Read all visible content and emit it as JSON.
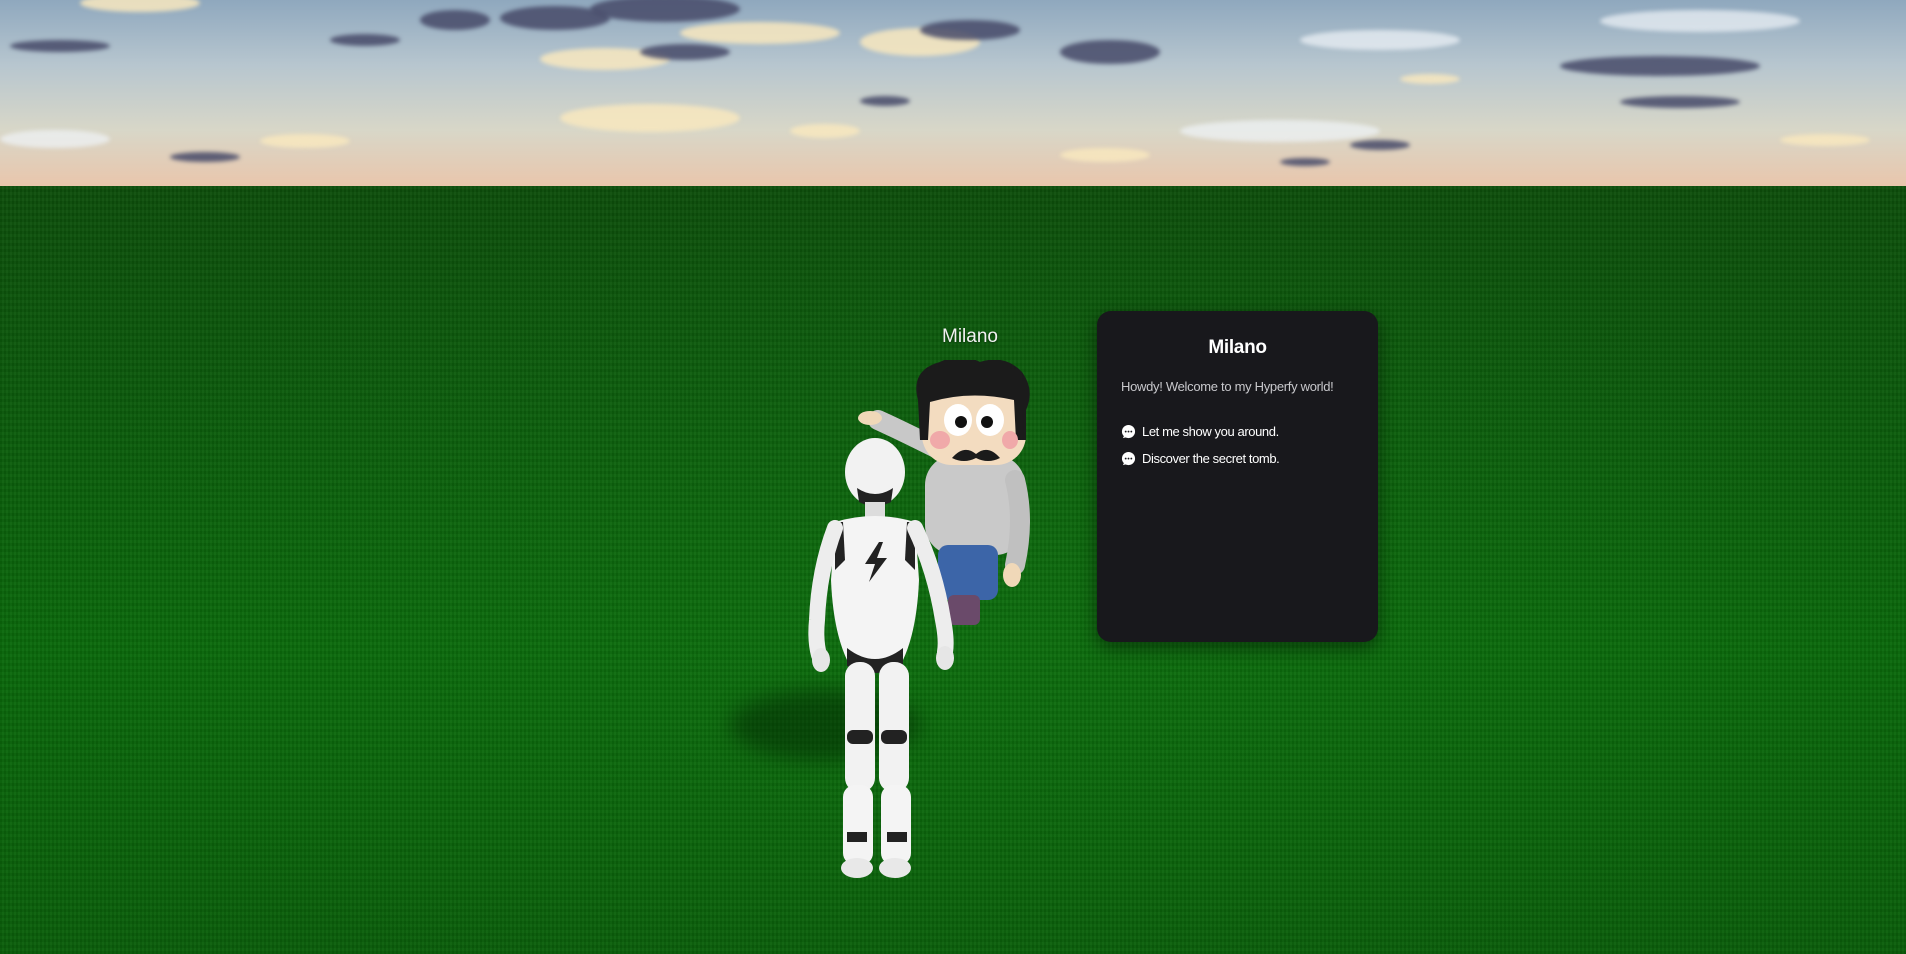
{
  "npc": {
    "nametag": "Milano"
  },
  "dialog": {
    "title": "Milano",
    "message": "Howdy! Welcome to my Hyperfy world!",
    "options": [
      {
        "label": "Let me show you around.",
        "icon": "chat-bubble-icon"
      },
      {
        "label": "Discover the secret tomb.",
        "icon": "chat-bubble-icon"
      }
    ]
  },
  "colors": {
    "panel_bg": "#18181c",
    "ground": "#0a6a0b",
    "sky": "#b7c6cf"
  }
}
